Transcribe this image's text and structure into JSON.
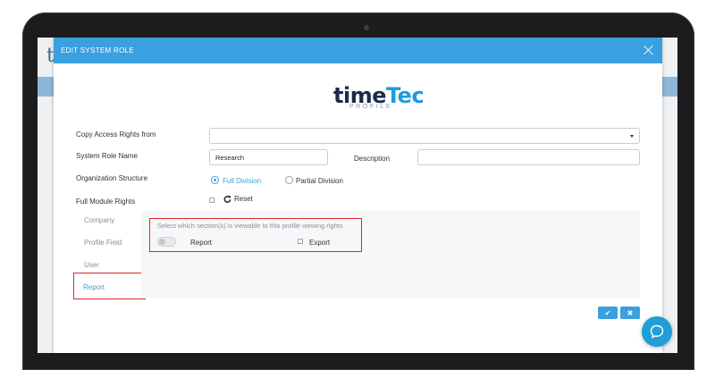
{
  "background": {
    "letter": "t"
  },
  "modal": {
    "title": "EDIT SYSTEM ROLE",
    "logo": {
      "brand_a": "time",
      "brand_b": "Tec",
      "sub": "PROFILE"
    },
    "fields": {
      "copy_label": "Copy Access Rights from",
      "copy_value": "",
      "role_name_label": "System Role Name",
      "role_name_value": "Research",
      "description_label": "Description",
      "description_value": "",
      "org_label": "Organization Structure",
      "org_full": "Full Division",
      "org_partial": "Partial Division",
      "module_label": "Full Module Rights",
      "reset_label": "Reset"
    },
    "sidebar": [
      {
        "label": "Company"
      },
      {
        "label": "Profile Field"
      },
      {
        "label": "User"
      },
      {
        "label": "Report"
      }
    ],
    "panel": {
      "instruction": "Select which section(s) is viewable to this profile viewing rights",
      "report_label": "Report",
      "export_label": "Export"
    },
    "buttons": {
      "save": "✔",
      "cancel": "✖"
    }
  },
  "colors": {
    "accent": "#3aa0df",
    "highlight": "#d9262c"
  }
}
